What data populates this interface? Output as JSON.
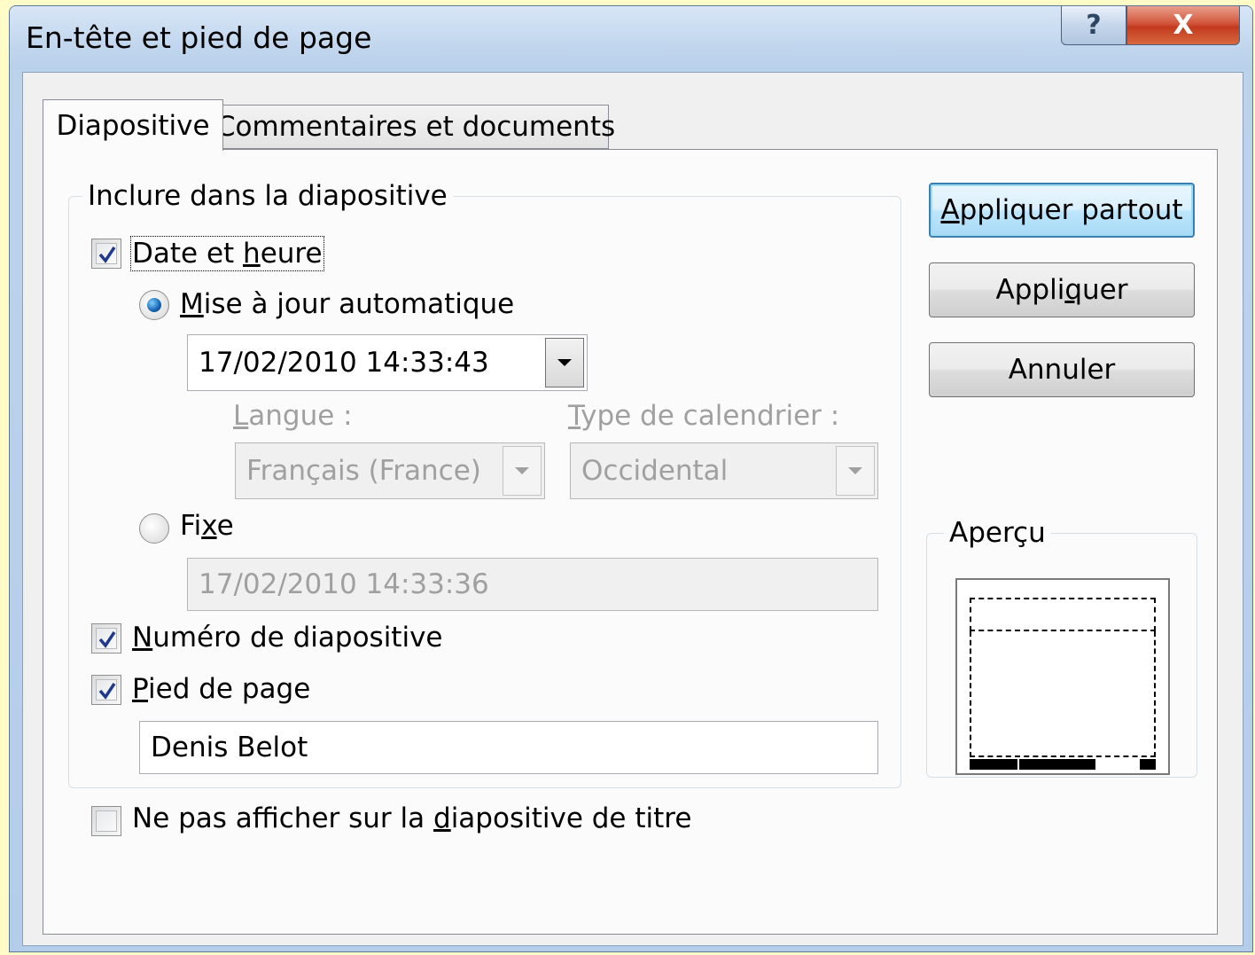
{
  "window": {
    "title": "En-tête et pied de page",
    "help_glyph": "?",
    "close_glyph": "X"
  },
  "tabs": [
    {
      "label": "Diapositive",
      "selected": true
    },
    {
      "label": "Commentaires et documents",
      "selected": false
    }
  ],
  "include_group": {
    "legend": "Inclure dans la diapositive",
    "date_time": {
      "label_pre": "Date et ",
      "label_accel": "h",
      "label_post": "eure",
      "checked": true
    },
    "auto_update": {
      "label_accel": "M",
      "label_post": "ise à jour automatique",
      "selected": true,
      "value": "17/02/2010 14:33:43"
    },
    "language": {
      "label_accel": "L",
      "label_post": "angue :",
      "value": "Français (France)"
    },
    "calendar": {
      "label_accel": "T",
      "label_post": "ype de calendrier :",
      "value": "Occidental"
    },
    "fixed": {
      "label_pre": "Fi",
      "label_accel": "x",
      "label_post": "e",
      "selected": false,
      "value": "17/02/2010 14:33:36"
    },
    "slide_number": {
      "label_accel": "N",
      "label_post": "uméro de diapositive",
      "checked": true
    },
    "footer": {
      "label_accel": "P",
      "label_post": "ied de page",
      "checked": true,
      "value": "Denis Belot"
    }
  },
  "dont_show_on_title": {
    "label_pre": "Ne pas afficher sur la ",
    "label_accel": "d",
    "label_post": "iapositive de titre",
    "checked": false
  },
  "buttons": {
    "apply_all": {
      "accel": "A",
      "rest": "ppliquer partout"
    },
    "apply": {
      "pre": "Appli",
      "accel": "q",
      "post": "uer"
    },
    "cancel": {
      "label": "Annuler"
    }
  },
  "preview": {
    "legend": "Aperçu"
  },
  "colors": {
    "default_button_border": "#3c7fb1",
    "radio_selected": "#1563b5",
    "checkmark": "#21398c",
    "close_button": "#c23a1e"
  }
}
